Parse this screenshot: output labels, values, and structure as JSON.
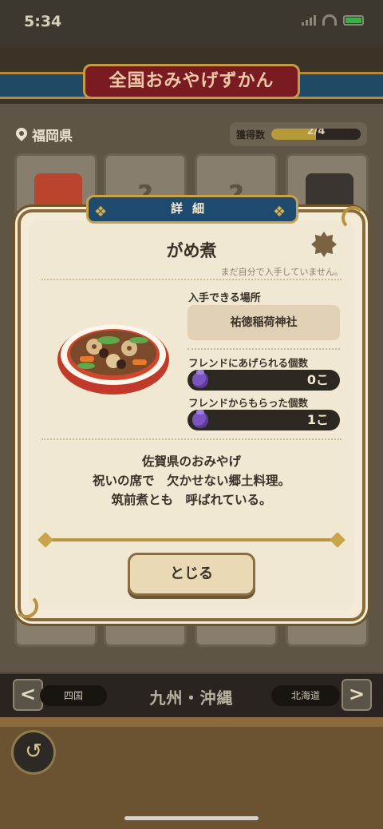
{
  "status": {
    "time": "5:34"
  },
  "header": {
    "title": "全国おみやげずかん"
  },
  "region": {
    "prefecture": "福岡県",
    "count_label": "獲得数",
    "count_text": "2/4",
    "count_fraction": 0.5
  },
  "cards": [
    {
      "label": "?"
    },
    {
      "label": "?"
    }
  ],
  "detail": {
    "header": "詳細",
    "item_name": "がめ煮",
    "not_owned": "まだ自分で入手していません。",
    "source_label": "入手できる場所",
    "source_value": "祐徳稲荷神社",
    "give_label": "フレンドにあげられる個数",
    "give_value": "0こ",
    "received_label": "フレンドからもらった個数",
    "received_value": "1こ",
    "desc_lines": [
      "佐賀県のおみやげ",
      "祝いの席で　欠かせない郷土料理。",
      "筑前煮とも　呼ばれている。"
    ],
    "close_label": "とじる"
  },
  "nav": {
    "prev_label": "四国",
    "current": "九州・沖縄",
    "next_label": "北海道",
    "prev_arrow": "<",
    "next_arrow": ">"
  },
  "icons": {
    "back": "back-arrow-icon",
    "location": "pin-icon",
    "bag": "bag-icon"
  },
  "colors": {
    "accent_gold": "#c8a24a",
    "header_blue": "#1f4a70",
    "banner_red": "#7a1b22"
  }
}
